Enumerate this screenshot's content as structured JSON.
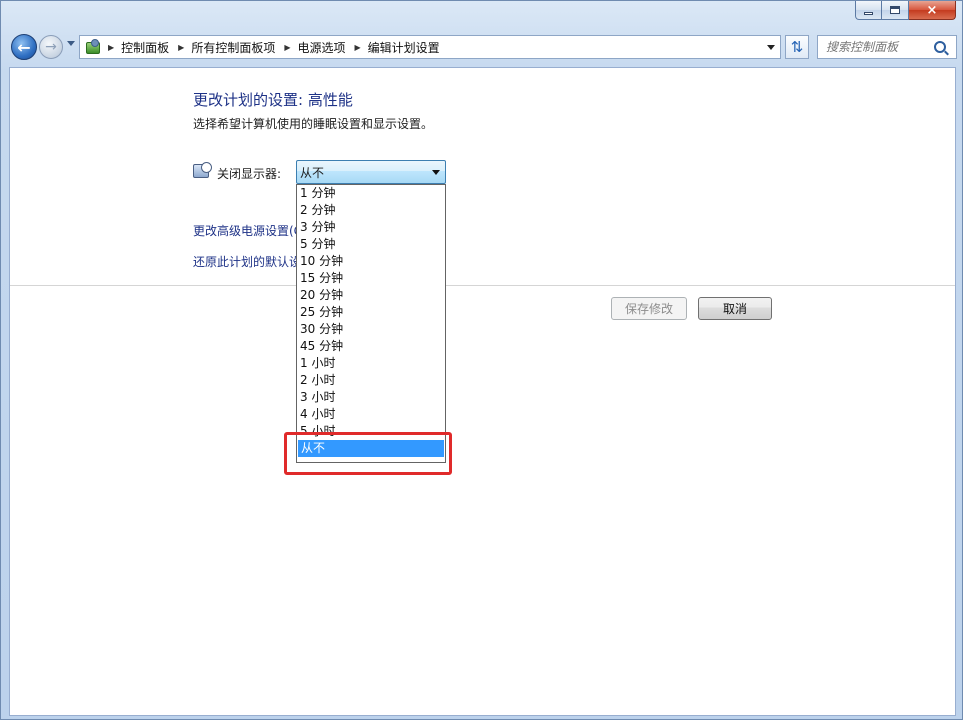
{
  "window": {
    "controls": {
      "minimize_icon": "minimize-icon",
      "maximize_icon": "maximize-icon",
      "close_label": "×"
    }
  },
  "toolbar": {
    "back_icon": "back-arrow-icon",
    "forward_icon": "forward-arrow-icon",
    "breadcrumbs": [
      "控制面板",
      "所有控制面板项",
      "电源选项",
      "编辑计划设置"
    ],
    "search_placeholder": "搜索控制面板"
  },
  "main": {
    "title": "更改计划的设置: 高性能",
    "subtitle": "选择希望计算机使用的睡眠设置和显示设置。",
    "display_label": "关闭显示器:",
    "display_value": "从不",
    "link_advanced": "更改高级电源设置(C)",
    "link_restore": "还原此计划的默认设置",
    "save_button": "保存修改",
    "cancel_button": "取消"
  },
  "dropdown": {
    "options": [
      "1 分钟",
      "2 分钟",
      "3 分钟",
      "5 分钟",
      "10 分钟",
      "15 分钟",
      "20 分钟",
      "25 分钟",
      "30 分钟",
      "45 分钟",
      "1 小时",
      "2 小时",
      "3 小时",
      "4 小时",
      "5 小时",
      "从不"
    ],
    "selected_index": 15,
    "highlight_color": "#e02a2a",
    "selection_color": "#3399ff"
  }
}
